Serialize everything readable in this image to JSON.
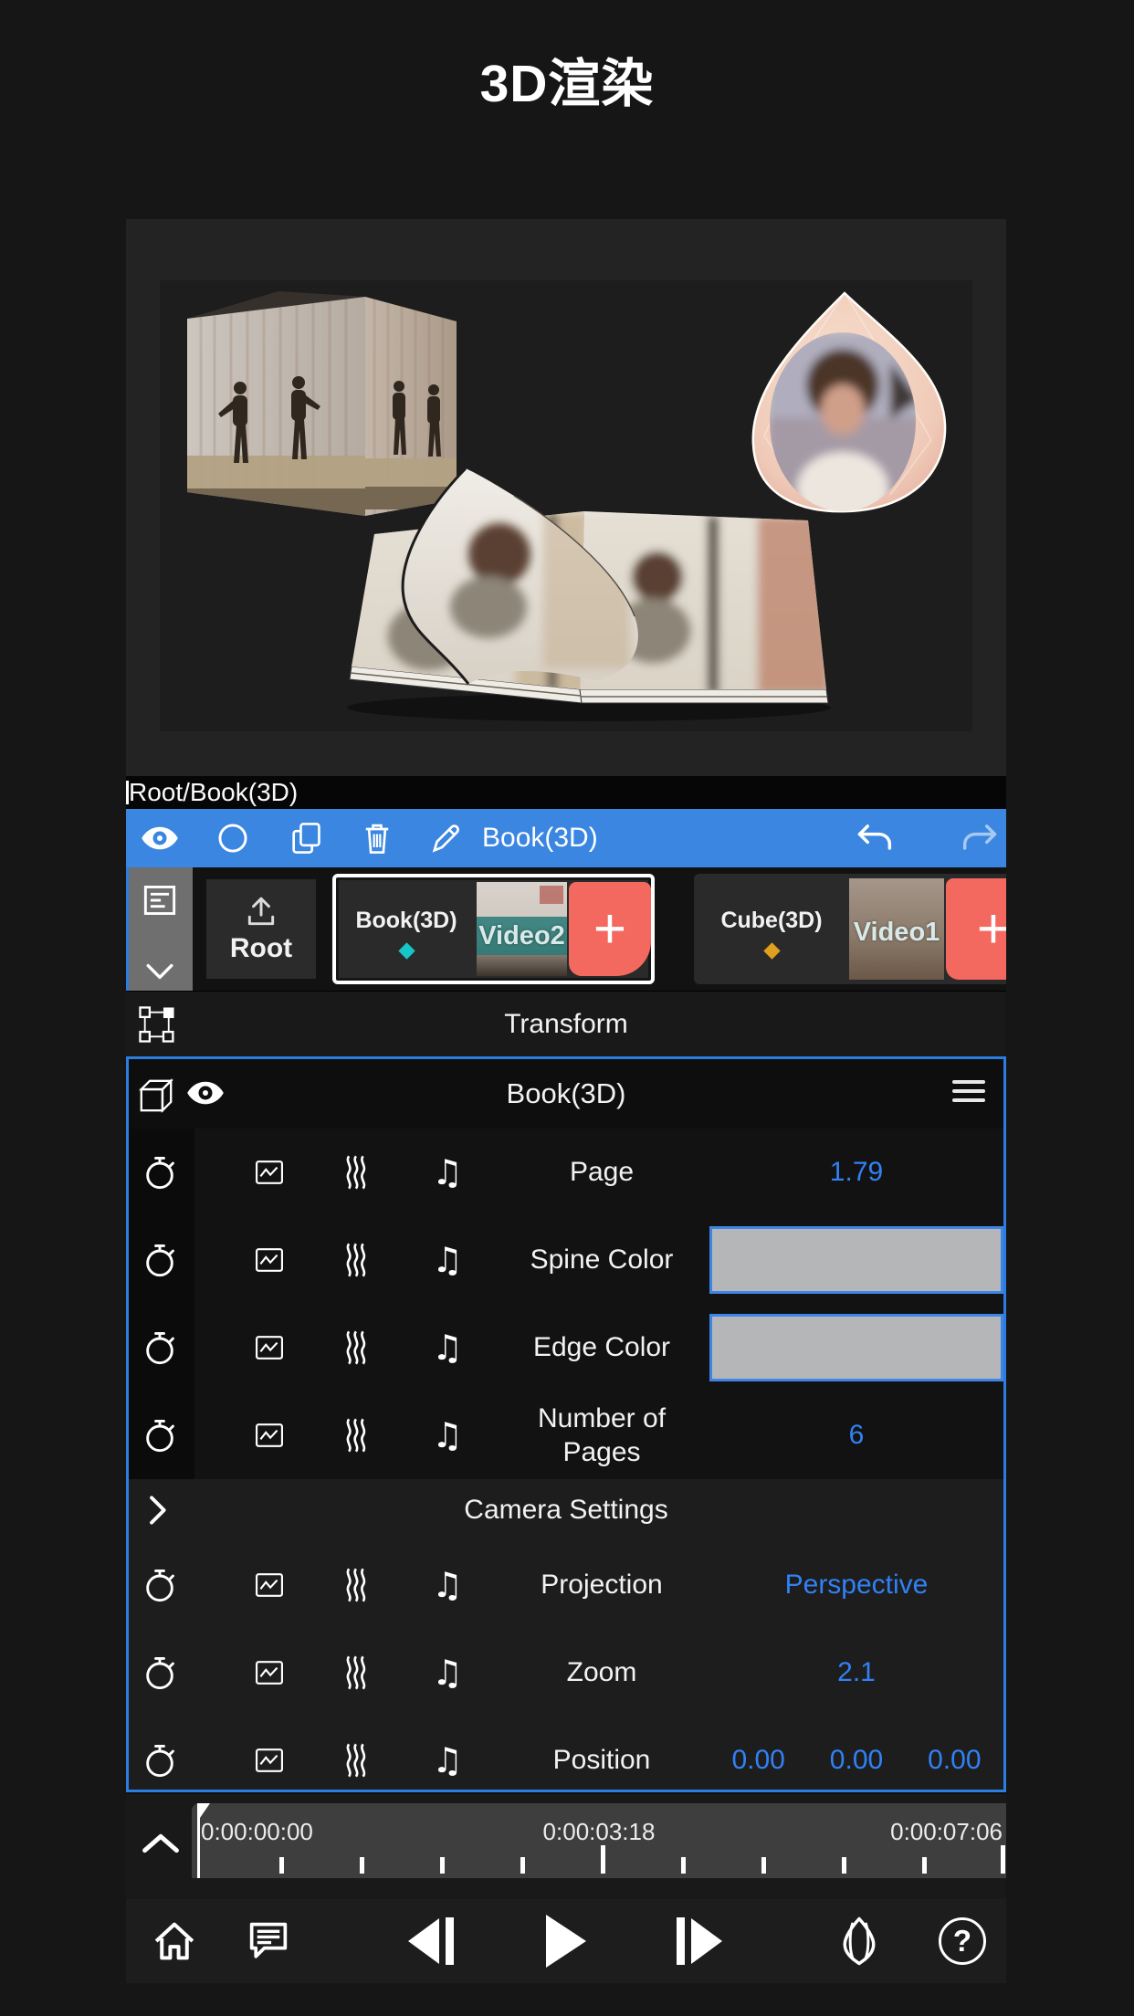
{
  "page": {
    "title": "3D渲染"
  },
  "breadcrumb": {
    "path": "Root/Book(3D)"
  },
  "toolbar": {
    "selection_label": "Book(3D)"
  },
  "tracks": {
    "root_label": "Root",
    "add_label": "+",
    "groups": [
      {
        "name": "Book(3D)",
        "clip": "Video2",
        "indicator_color": "#17c6c9",
        "selected": true
      },
      {
        "name": "Cube(3D)",
        "clip": "Video1",
        "indicator_color": "#e09f1f",
        "selected": false
      }
    ]
  },
  "transform": {
    "label": "Transform"
  },
  "panel": {
    "title": "Book(3D)",
    "rows": [
      {
        "label": "Page",
        "value": "1.79"
      },
      {
        "label": "Spine Color",
        "swatch_color": "#b5b6b8"
      },
      {
        "label": "Edge Color",
        "swatch_color": "#b5b6b8"
      },
      {
        "label": "Number of Pages",
        "value": "6"
      }
    ],
    "section_label": "Camera Settings",
    "camera_rows": [
      {
        "label": "Projection",
        "value": "Perspective"
      },
      {
        "label": "Zoom",
        "value": "2.1"
      },
      {
        "label": "Position",
        "values": [
          "0.00",
          "0.00",
          "0.00"
        ]
      }
    ]
  },
  "timeline": {
    "timestamps": [
      "0:00:00:00",
      "0:00:03:18",
      "0:00:07:06"
    ]
  },
  "bottombar": {
    "help_glyph": "?"
  },
  "icons": {
    "music_note_glyph": "♫"
  },
  "colors": {
    "accent_blue": "#3a86e0",
    "value_blue": "#3181f5",
    "panel_border_blue": "#2b7de2",
    "add_button_red": "#f4695f",
    "book_indicator_teal": "#17c6c9",
    "cube_indicator_orange": "#e09f1f",
    "swatch_gray": "#b5b6b8",
    "ruler_gray": "#3e3e3e"
  }
}
